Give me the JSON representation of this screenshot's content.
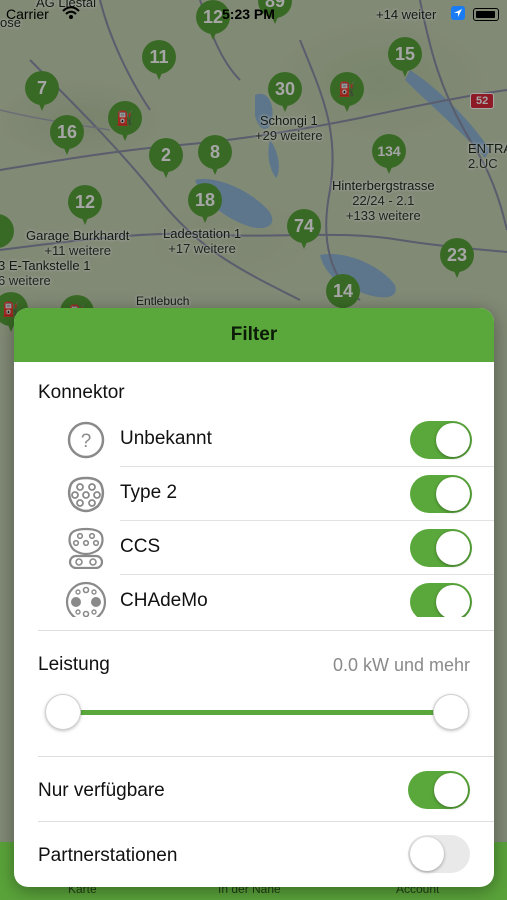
{
  "status_bar": {
    "carrier": "Carrier",
    "time": "5:23 PM"
  },
  "map": {
    "pins": [
      {
        "label": "12"
      },
      {
        "label": "89"
      },
      {
        "label": "11"
      },
      {
        "label": "15"
      },
      {
        "label": "7"
      },
      {
        "label": "30"
      },
      {
        "label": "16"
      },
      {
        "label": "2"
      },
      {
        "label": "8"
      },
      {
        "label": "134"
      },
      {
        "label": "12"
      },
      {
        "label": "18"
      },
      {
        "label": "74"
      },
      {
        "label": "23"
      },
      {
        "label": "14"
      }
    ],
    "labels": {
      "ag_liestal": "AG Liestal",
      "weiter_top": "+14 weiter",
      "ose": "ose",
      "schongi": "Schongi 1",
      "schongi_more": "+29 weitere",
      "hinterberg": "Hinterbergstrasse",
      "hinterberg2": "22/24 - 2.1",
      "hinterberg_more": "+133 weitere",
      "garage": "Garage Burkhardt",
      "garage_more": "+11 weitere",
      "etank": "3 E-Tankstelle 1",
      "etank_more": "6 weitere",
      "ladestation": "Ladestation 1",
      "ladestation_more": "+17 weitere",
      "entra": "ENTRA",
      "entra2": "2.UC",
      "entlebuch": "Entlebuch",
      "hwy": "52"
    }
  },
  "tab_bar": {
    "tabs": [
      {
        "label": "Karte"
      },
      {
        "label": "In der Nähe"
      },
      {
        "label": "Account"
      }
    ]
  },
  "filter": {
    "title": "Filter",
    "connector_section": "Konnektor",
    "connectors": [
      {
        "label": "Unbekannt",
        "icon": "unknown-connector-icon",
        "enabled": true
      },
      {
        "label": "Type 2",
        "icon": "type2-connector-icon",
        "enabled": true
      },
      {
        "label": "CCS",
        "icon": "ccs-connector-icon",
        "enabled": true
      },
      {
        "label": "CHAdeMo",
        "icon": "chademo-connector-icon",
        "enabled": true
      }
    ],
    "power_section": "Leistung",
    "power_value": "0.0 kW und mehr",
    "power_range": {
      "min_fraction": 0.0,
      "max_fraction": 1.0
    },
    "only_available_label": "Nur verfügbare",
    "only_available": true,
    "partner_label": "Partnerstationen",
    "partner": false,
    "accent_color": "#5aa83b"
  }
}
